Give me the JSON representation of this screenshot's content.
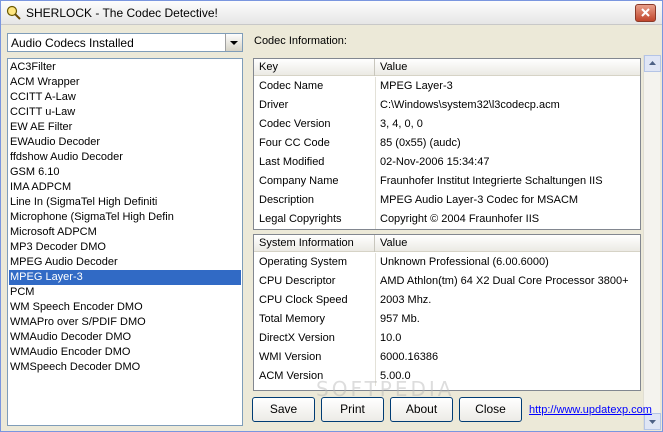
{
  "window": {
    "title": "SHERLOCK - The Codec Detective!"
  },
  "combo": {
    "selected": "Audio Codecs Installed"
  },
  "codec_list": {
    "items": [
      "AC3Filter",
      "ACM Wrapper",
      "CCITT A-Law",
      "CCITT u-Law",
      "EW AE Filter",
      "EWAudio Decoder",
      "ffdshow Audio Decoder",
      "GSM 6.10",
      "IMA ADPCM",
      "Line In (SigmaTel High Definiti",
      "Microphone (SigmaTel High Defin",
      "Microsoft ADPCM",
      "MP3 Decoder DMO",
      "MPEG Audio Decoder",
      "MPEG Layer-3",
      "PCM",
      "WM Speech Encoder DMO",
      "WMAPro over S/PDIF DMO",
      "WMAudio Decoder DMO",
      "WMAudio Encoder DMO",
      "WMSpeech Decoder DMO"
    ],
    "selected_index": 14
  },
  "codec_info": {
    "label": "Codec Information:",
    "col_key": "Key",
    "col_value": "Value",
    "rows": [
      {
        "key": "Codec Name",
        "value": "MPEG Layer-3"
      },
      {
        "key": "Driver",
        "value": "C:\\Windows\\system32\\l3codecp.acm"
      },
      {
        "key": "Codec Version",
        "value": "3, 4, 0, 0"
      },
      {
        "key": "Four CC Code",
        "value": "85 (0x55) (audc)"
      },
      {
        "key": "Last Modified",
        "value": "02-Nov-2006 15:34:47"
      },
      {
        "key": "Company Name",
        "value": "Fraunhofer Institut Integrierte Schaltungen IIS"
      },
      {
        "key": "Description",
        "value": "MPEG Audio Layer-3 Codec for MSACM"
      },
      {
        "key": "Legal Copyrights",
        "value": "Copyright © 2004 Fraunhofer IIS"
      }
    ]
  },
  "system_info": {
    "col_key": "System Information",
    "col_value": "Value",
    "rows": [
      {
        "key": "Operating System",
        "value": "Unknown Professional (6.00.6000)"
      },
      {
        "key": "CPU Descriptor",
        "value": "AMD Athlon(tm) 64 X2 Dual Core Processor 3800+"
      },
      {
        "key": "CPU Clock Speed",
        "value": "2003 Mhz."
      },
      {
        "key": "Total Memory",
        "value": "957 Mb."
      },
      {
        "key": "DirectX Version",
        "value": "10.0"
      },
      {
        "key": "WMI Version",
        "value": "6000.16386"
      },
      {
        "key": "ACM Version",
        "value": "5.00.0"
      }
    ]
  },
  "buttons": {
    "save": "Save",
    "print": "Print",
    "about": "About",
    "close": "Close"
  },
  "link": "http://www.updatexp.com",
  "watermark": "SOFTPEDIA",
  "colors": {
    "selection": "#316ac5",
    "face": "#ece9d8",
    "link": "#0000ff"
  }
}
